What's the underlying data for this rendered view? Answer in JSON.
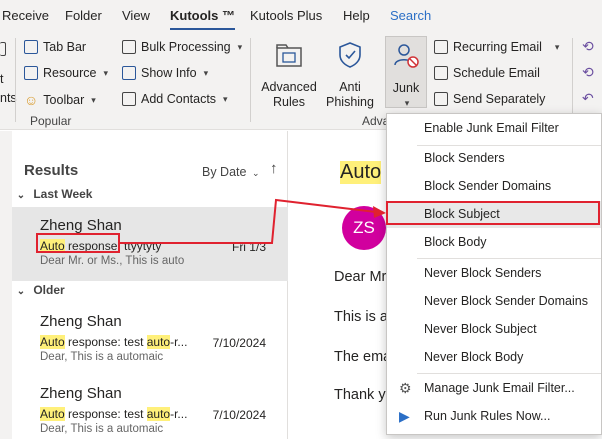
{
  "menu": {
    "tabs": [
      "Receive",
      "Folder",
      "View",
      "Kutools ™",
      "Kutools Plus",
      "Help",
      "Search"
    ],
    "active": "Kutools ™"
  },
  "ribbon": {
    "left_cut": [
      "t",
      "nts"
    ],
    "items": {
      "tab_bar": "Tab Bar",
      "resource": "Resource",
      "toolbar": "Toolbar",
      "bulk_processing": "Bulk Processing",
      "show_info": "Show Info",
      "add_contacts": "Add Contacts",
      "advanced_rules": "Advanced Rules",
      "anti_phishing": "Anti Phishing",
      "junk": "Junk",
      "recurring_email": "Recurring Email",
      "schedule_email": "Schedule Email",
      "send_separately": "Send Separately"
    },
    "group_popular": "Popular",
    "group_adv_partial": "Adva"
  },
  "results": {
    "title": "Results",
    "sort": "By Date",
    "sections": [
      {
        "label": "Last Week",
        "mails": [
          {
            "from": "Zheng Shan",
            "subject_hl": "Auto",
            "subject_rest": " response: ttyytyty",
            "date": "Fri 1/3",
            "preview": "Dear Mr. or Ms.,  This is auto"
          }
        ]
      },
      {
        "label": "Older",
        "mails": [
          {
            "from": "Zheng Shan",
            "subject_hl": "Auto",
            "subject_mid": " response: test ",
            "subject_hl2": "auto",
            "subject_tail": "-r...",
            "date": "7/10/2024",
            "preview": "Dear,  This is a automaic"
          },
          {
            "from": "Zheng Shan",
            "subject_hl": "Auto",
            "subject_mid": " response: test ",
            "subject_hl2": "auto",
            "subject_tail": "-r...",
            "date": "7/10/2024",
            "preview": "Dear,  This is a automaic"
          }
        ]
      }
    ]
  },
  "reading": {
    "title": "Auto",
    "avatar": "ZS",
    "lines": [
      "Dear Mr",
      "This is a",
      "The ema",
      "Thank y"
    ]
  },
  "junk_menu": {
    "items": [
      "Enable Junk Email Filter",
      "Block Senders",
      "Block Sender Domains",
      "Block Subject",
      "Block Body",
      "Never Block Senders",
      "Never Block Sender Domains",
      "Never Block Subject",
      "Never Block Body",
      "Manage Junk Email Filter...",
      "Run Junk Rules Now..."
    ],
    "highlighted": "Block Subject"
  },
  "colors": {
    "accent": "#2b579a",
    "highlight": "#fff07a",
    "annotation": "#e0222f",
    "avatar": "#d1009e"
  }
}
